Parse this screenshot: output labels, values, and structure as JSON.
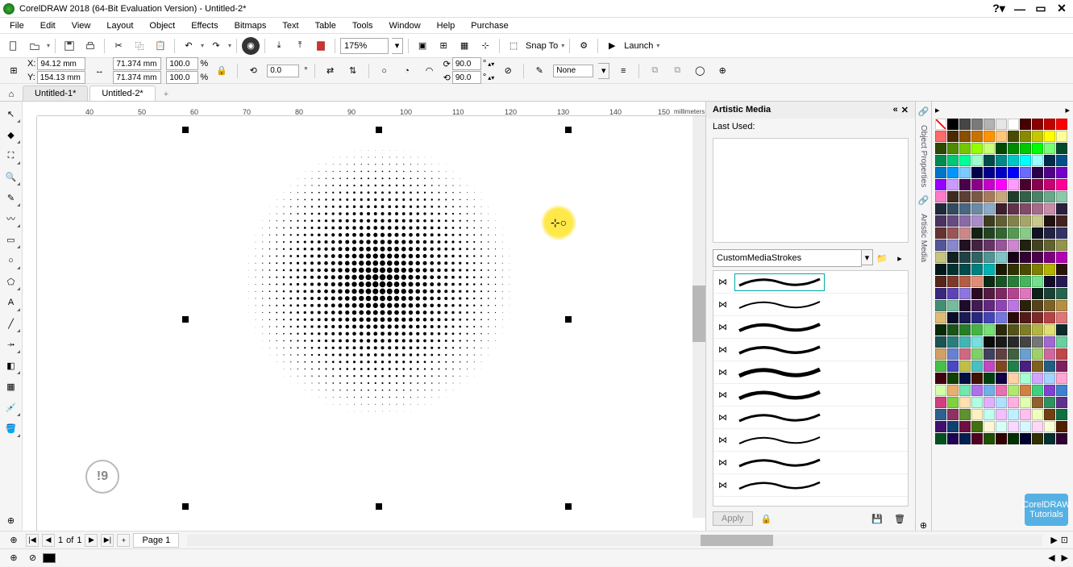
{
  "title": "CorelDRAW 2018 (64-Bit Evaluation Version) - Untitled-2*",
  "menu": [
    "File",
    "Edit",
    "View",
    "Layout",
    "Object",
    "Effects",
    "Bitmaps",
    "Text",
    "Table",
    "Tools",
    "Window",
    "Help",
    "Purchase"
  ],
  "toolbar": {
    "zoom": "175%",
    "snapTo": "Snap To",
    "launch": "Launch"
  },
  "propbar": {
    "xLabel": "X:",
    "x": "94.12 mm",
    "yLabel": "Y:",
    "y": "154.13 mm",
    "w": "71.374 mm",
    "h": "71.374 mm",
    "sx": "100.0",
    "sy": "100.0",
    "pct": "%",
    "rot": "0.0",
    "ang1": "90.0",
    "ang2": "90.0",
    "deg": "°",
    "outline": "None"
  },
  "tabs": {
    "t1": "Untitled-1*",
    "t2": "Untitled-2*",
    "add": "+"
  },
  "rulerTicks": [
    "40",
    "50",
    "60",
    "70",
    "80",
    "90",
    "100",
    "110",
    "120",
    "130",
    "140",
    "150"
  ],
  "rulerUnit": "millimeters",
  "artistic": {
    "title": "Artistic Media",
    "lastUsed": "Last Used:",
    "category": "CustomMediaStrokes",
    "apply": "Apply"
  },
  "docker": {
    "p1": "Object Properties",
    "p2": "Artistic Media"
  },
  "pagebar": {
    "cur": "1",
    "of": "of",
    "total": "1",
    "page": "Page 1",
    "plus": "+"
  },
  "hint": "!9",
  "watermark": {
    "l1": "CorelDRAW",
    "l2": "Tutorials"
  },
  "colors": [
    "#000000",
    "#464646",
    "#7a7a7a",
    "#b3b3b3",
    "#e6e6e6",
    "#ffffff",
    "#470000",
    "#8a0000",
    "#c10000",
    "#ff0000",
    "#ff6a6a",
    "#4a2a00",
    "#8a4f00",
    "#c77300",
    "#ff9400",
    "#ffc77a",
    "#4a4a00",
    "#8a8a00",
    "#c7c700",
    "#ffff00",
    "#ffff9a",
    "#2b4a00",
    "#508a00",
    "#74c700",
    "#96ff00",
    "#c9ff7a",
    "#004a00",
    "#008a00",
    "#00c700",
    "#00ff00",
    "#7aff7a",
    "#004a2b",
    "#008a50",
    "#00c774",
    "#00ff96",
    "#9affcc",
    "#004a4a",
    "#008a8a",
    "#00c7c7",
    "#00ffff",
    "#9affff",
    "#002b4a",
    "#00508a",
    "#0074c7",
    "#0096ff",
    "#7ac9ff",
    "#00004a",
    "#00008a",
    "#0000c7",
    "#0000ff",
    "#6a6aff",
    "#2b004a",
    "#50008a",
    "#7400c7",
    "#9600ff",
    "#cc9aff",
    "#4a004a",
    "#8a008a",
    "#c700c7",
    "#ff00ff",
    "#ff9aff",
    "#4a002b",
    "#8a0050",
    "#c70074",
    "#ff0096",
    "#ff7ac9",
    "#3d2b1f",
    "#5c4033",
    "#7b5a45",
    "#a67b5b",
    "#c9a77e",
    "#1f3d2b",
    "#33604a",
    "#4a8266",
    "#6aa68a",
    "#8cc9aa",
    "#1f2b3d",
    "#334a60",
    "#4a6682",
    "#6a8aa6",
    "#8caac9",
    "#3d1f2b",
    "#60334a",
    "#824a66",
    "#a66a8a",
    "#c98caa",
    "#2b1f3d",
    "#4a3360",
    "#664a82",
    "#8a6aa6",
    "#aa8cc9",
    "#3d3d1f",
    "#606033",
    "#82824a",
    "#a6a66a",
    "#c9c98c",
    "#221111",
    "#442222",
    "#663333",
    "#995555",
    "#cc8888",
    "#112211",
    "#224422",
    "#336633",
    "#559955",
    "#88cc88",
    "#111122",
    "#222244",
    "#333366",
    "#555599",
    "#8888cc",
    "#221122",
    "#442244",
    "#663366",
    "#995599",
    "#cc88cc",
    "#212110",
    "#424220",
    "#636330",
    "#949450",
    "#c5c580",
    "#102121",
    "#204242",
    "#306363",
    "#509494",
    "#80c5c5",
    "#190019",
    "#320032",
    "#4c004c",
    "#7f007f",
    "#b200b2",
    "#001919",
    "#003232",
    "#004c4c",
    "#007f7f",
    "#00b2b2",
    "#191900",
    "#323200",
    "#4c4c00",
    "#7f7f00",
    "#b2b200",
    "#2a130b",
    "#54261a",
    "#7e3928",
    "#b55c44",
    "#df8d76",
    "#0b2a13",
    "#1a5426",
    "#287e39",
    "#44b55c",
    "#76df8d",
    "#130b2a",
    "#261a54",
    "#39287e",
    "#5c44b5",
    "#8d76df",
    "#2a0b21",
    "#541a42",
    "#7e2863",
    "#b5448f",
    "#df76bc",
    "#0b211a",
    "#1a4234",
    "#28634e",
    "#448f72",
    "#76bc9e",
    "#210b2a",
    "#421a54",
    "#63287e",
    "#8f44b5",
    "#bc76df",
    "#2a210b",
    "#54421a",
    "#7e6328",
    "#b58f44",
    "#dfbc76",
    "#0b0b2a",
    "#1a1a54",
    "#28287e",
    "#4444b5",
    "#7676df",
    "#2a0b0b",
    "#541a1a",
    "#7e2828",
    "#b54444",
    "#df7676",
    "#0b2a0b",
    "#1a541a",
    "#287e28",
    "#44b544",
    "#76df76",
    "#2a2a0b",
    "#54541a",
    "#7e7e28",
    "#b5b544",
    "#dfdf76",
    "#0b2a2a",
    "#1a5454",
    "#287e7e",
    "#44b5b5",
    "#76dfdf",
    "#0b0b0b",
    "#1a1a1a",
    "#282828",
    "#444444",
    "#767676",
    "#a068d0",
    "#68d0a0",
    "#d0a068",
    "#6880d0",
    "#d06880",
    "#80d068",
    "#404060",
    "#604040",
    "#406040",
    "#68a0d0",
    "#a0d068",
    "#d068a0",
    "#c04848",
    "#48c048",
    "#4848c0",
    "#c0c048",
    "#48c0c0",
    "#c048c0",
    "#804820",
    "#208048",
    "#482080",
    "#806020",
    "#206080",
    "#802060",
    "#400010",
    "#104000",
    "#001040",
    "#401000",
    "#004010",
    "#100040",
    "#ffd2a6",
    "#a6ffd2",
    "#d2a6ff",
    "#a6d2ff",
    "#ffa6d2",
    "#d2ffa6",
    "#e8b070",
    "#70e8b0",
    "#b070e8",
    "#70b0e8",
    "#e870b0",
    "#b0e870",
    "#d08040",
    "#40d080",
    "#8040d0",
    "#4080d0",
    "#d04080",
    "#80d040",
    "#ffe0b0",
    "#b0ffe0",
    "#e0b0ff",
    "#b0e0ff",
    "#ffb0e0",
    "#e0ffb0",
    "#906030",
    "#309060",
    "#603090",
    "#306090",
    "#903060",
    "#609030",
    "#fff0c0",
    "#c0fff0",
    "#f0c0ff",
    "#c0f0ff",
    "#ffc0f0",
    "#f0ffc0",
    "#704010",
    "#107040",
    "#401070",
    "#104070",
    "#701040",
    "#407010",
    "#fff8d8",
    "#d8fff8",
    "#f8d8ff",
    "#d8f8ff",
    "#ffd8f8",
    "#f8ffd8",
    "#502000",
    "#005020",
    "#200050",
    "#002050",
    "#500020",
    "#205000",
    "#300000",
    "#003000",
    "#000030",
    "#303000",
    "#003030",
    "#300030"
  ]
}
